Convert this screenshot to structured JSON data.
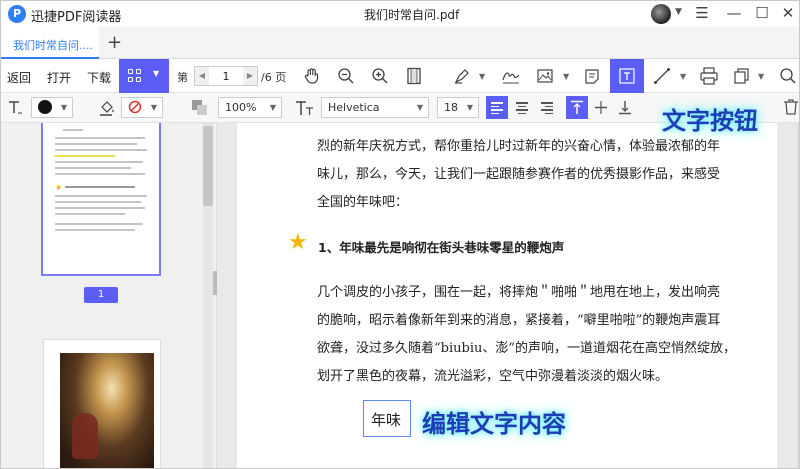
{
  "app": {
    "name": "迅捷PDF阅读器",
    "document_title": "我们时常自问.pdf"
  },
  "tabs": [
    {
      "label": "我们时常自问...."
    }
  ],
  "toolbar": {
    "back": "返回",
    "open": "打开",
    "download": "下载",
    "page_prefix": "第",
    "page_current": "1",
    "page_total": "/6 页"
  },
  "format_bar": {
    "zoom": "100%",
    "font_family": "Helvetica",
    "font_size": "18"
  },
  "sidebar": {
    "page_badge": "1"
  },
  "document": {
    "lines": [
      "烈的新年庆祝方式，帮你重拾儿时过新年的兴奋心情，体验最浓郁的年",
      "味儿，那么，今天，让我们一起跟随参赛作者的优秀摄影作品，来感受",
      "全国的年味吧："
    ],
    "heading": "1、年味最先是响彻在街头巷味零星的鞭炮声",
    "para2": [
      "几个调皮的小孩子，围在一起，将摔炮＂啪啪＂地甩在地上，发出响亮",
      "的脆响，昭示着像新年到来的消息，紧接着，“噼里啪啦”的鞭炮声震耳",
      "欲聋，没过多久随着“biubiu、澎”的声响，一道道烟花在高空悄然绽放，",
      "划开了黑色的夜幕，流光溢彩，空气中弥漫着淡淡的烟火味。"
    ],
    "edit_box_text": "年味"
  },
  "annotations": {
    "text_button": "文字按钮",
    "edit_text": "编辑文字内容",
    "color": "#1e3db5"
  },
  "colors": {
    "accent": "#5b5ef6",
    "brand": "#2f7ef3"
  }
}
